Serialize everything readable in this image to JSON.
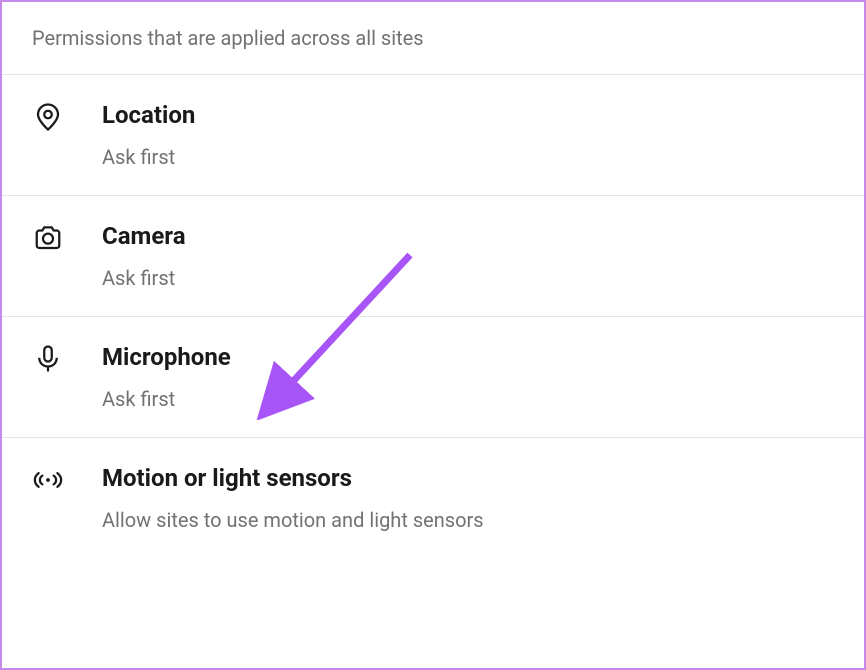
{
  "header": {
    "description": "Permissions that are applied across all sites"
  },
  "permissions": [
    {
      "title": "Location",
      "subtitle": "Ask first",
      "icon": "location"
    },
    {
      "title": "Camera",
      "subtitle": "Ask first",
      "icon": "camera"
    },
    {
      "title": "Microphone",
      "subtitle": "Ask first",
      "icon": "microphone"
    },
    {
      "title": "Motion or light sensors",
      "subtitle": "Allow sites to use motion and light sensors",
      "icon": "motion"
    }
  ],
  "annotation": {
    "arrow_color": "#a855f7",
    "points_to": "Microphone"
  }
}
